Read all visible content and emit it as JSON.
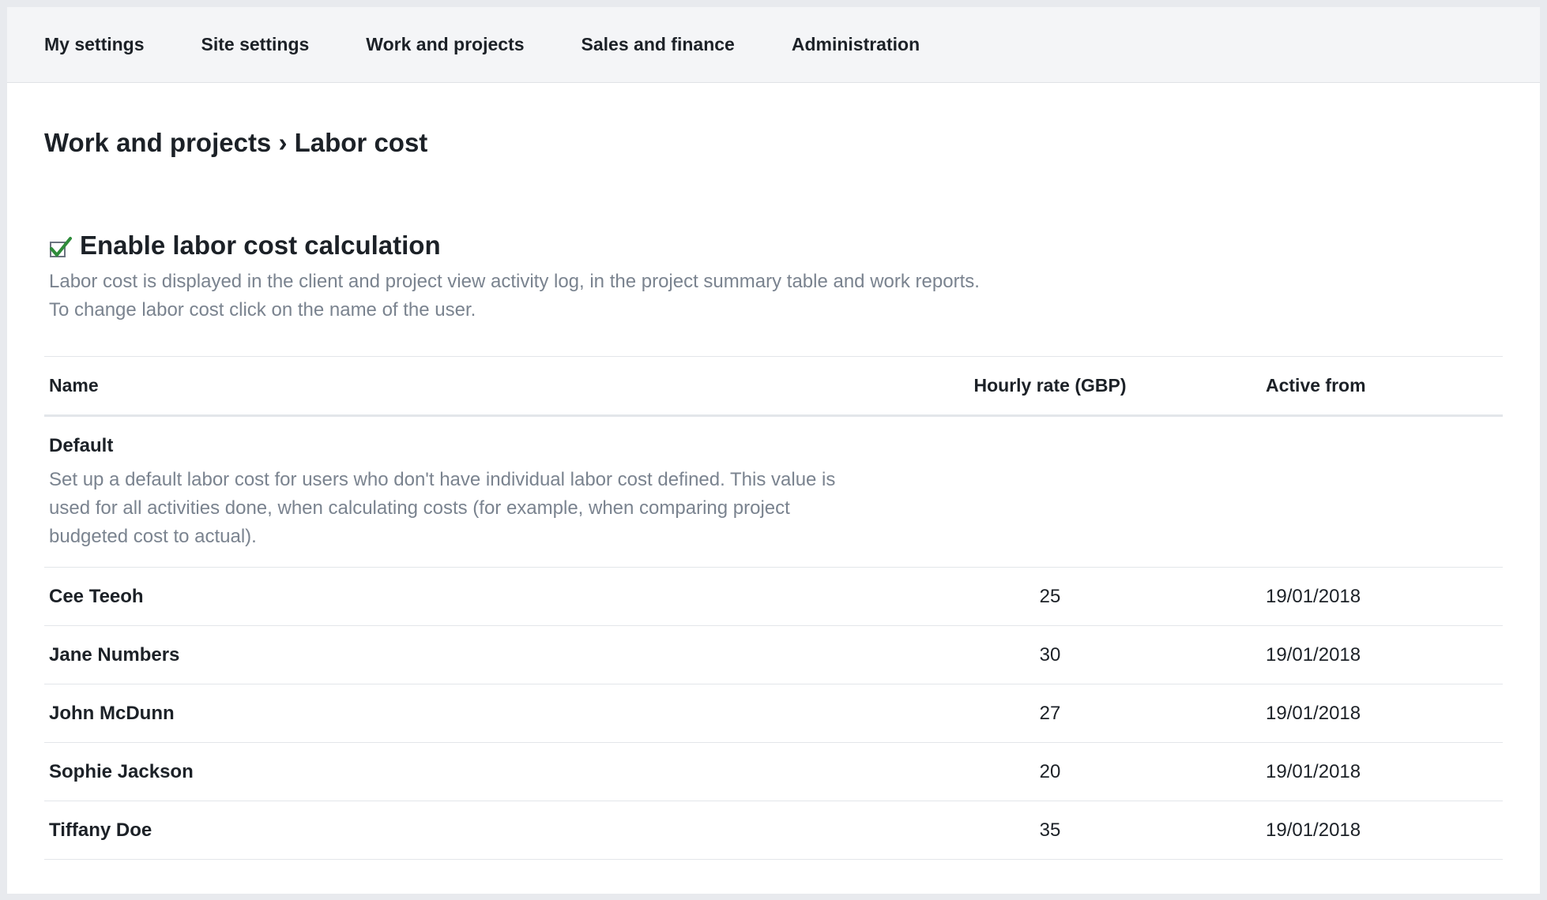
{
  "nav": {
    "items": [
      "My settings",
      "Site settings",
      "Work and projects",
      "Sales and finance",
      "Administration"
    ]
  },
  "page": {
    "title": "Work and projects › Labor cost"
  },
  "enable": {
    "label": "Enable labor cost calculation",
    "checked": true,
    "desc_line1": "Labor cost is displayed in the client and project view activity log, in the project summary table and work reports.",
    "desc_line2": "To change labor cost click on the name of the user."
  },
  "table": {
    "headers": {
      "name": "Name",
      "rate": "Hourly rate (GBP)",
      "active": "Active from"
    },
    "default_row": {
      "title": "Default",
      "desc": "Set up a default labor cost for users who don't have individual labor cost defined. This value is used for all activities done, when calculating costs (for example, when comparing project budgeted cost to actual)."
    },
    "rows": [
      {
        "name": "Cee Teeoh",
        "rate": "25",
        "active": "19/01/2018"
      },
      {
        "name": "Jane Numbers",
        "rate": "30",
        "active": "19/01/2018"
      },
      {
        "name": "John McDunn",
        "rate": "27",
        "active": "19/01/2018"
      },
      {
        "name": "Sophie Jackson",
        "rate": "20",
        "active": "19/01/2018"
      },
      {
        "name": "Tiffany Doe",
        "rate": "35",
        "active": "19/01/2018"
      }
    ]
  },
  "colors": {
    "check": "#2e8b3a",
    "muted_text": "#7a838f",
    "nav_bg": "#f4f5f7"
  },
  "icons": {
    "enable_checkbox": "checkmark-icon"
  }
}
